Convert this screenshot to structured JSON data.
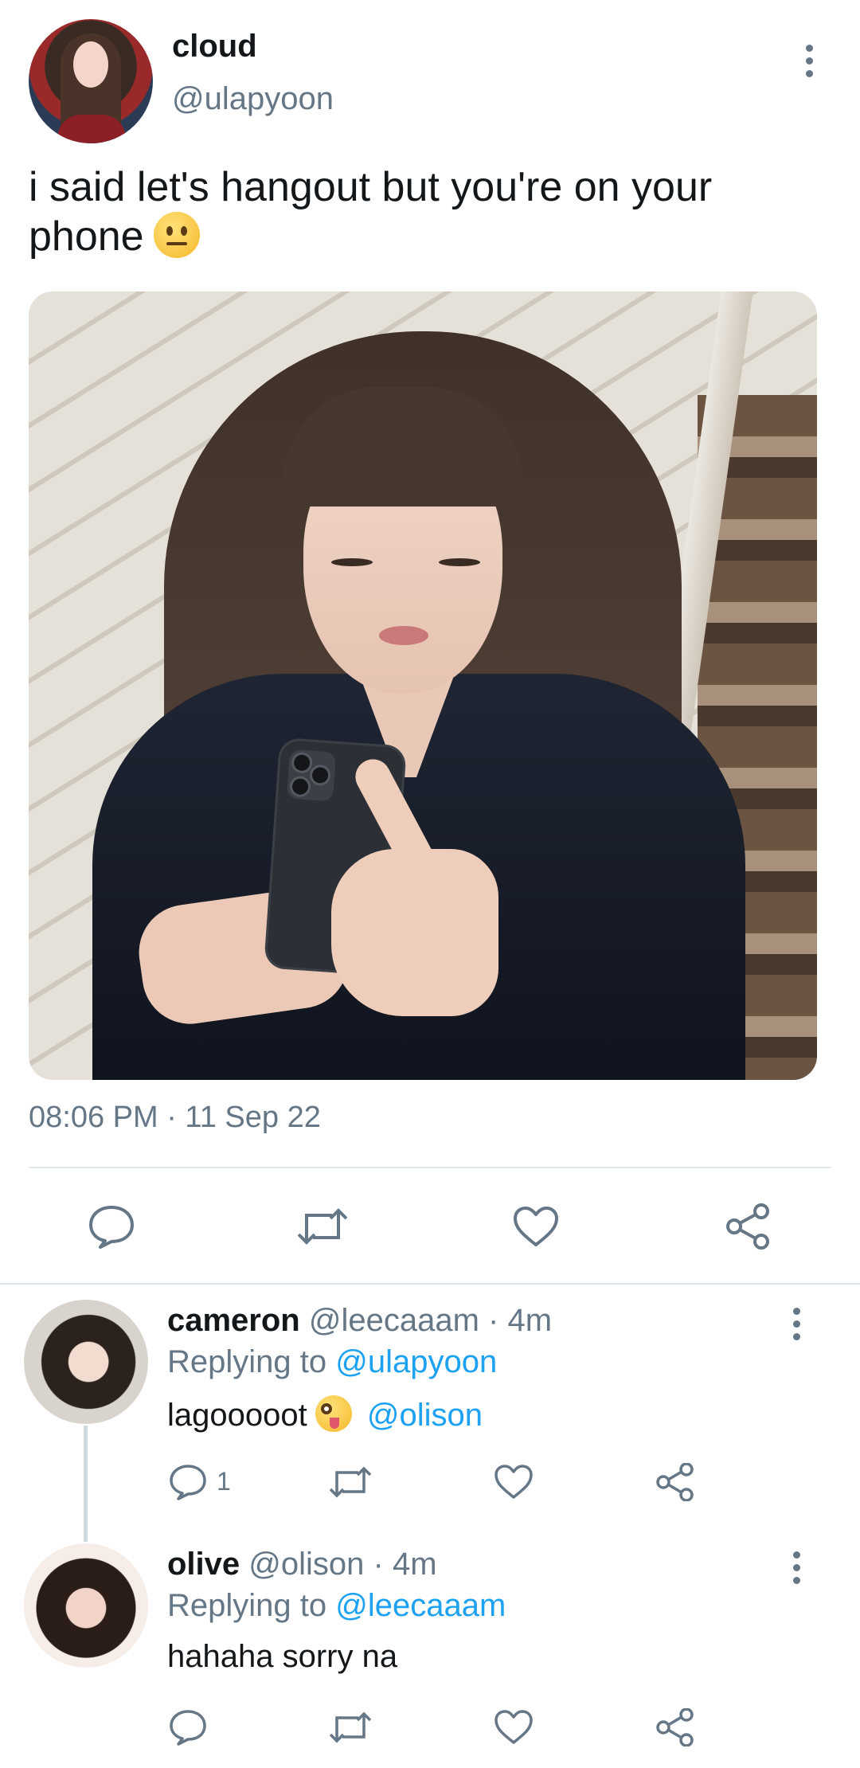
{
  "tweet": {
    "display_name": "cloud",
    "handle": "@ulapyoon",
    "text": "i said let's hangout but you're on your phone",
    "emoji": "neutral-face",
    "timestamp": "08:06 PM · 11 Sep 22",
    "actions": [
      "reply-icon",
      "retweet-icon",
      "like-icon",
      "share-icon"
    ]
  },
  "replies": [
    {
      "display_name": "cameron",
      "handle": "@leecaaam",
      "time": "· 4m",
      "replying_prefix": "Replying to",
      "replying_to": "@ulapyoon",
      "text": "lagooooot",
      "emoji": "zany-face",
      "mention": "@olison",
      "reply_count": "1"
    },
    {
      "display_name": "olive",
      "handle": "@olison",
      "time": "· 4m",
      "replying_prefix": "Replying to",
      "replying_to": "@leecaaam",
      "text": "hahaha sorry na"
    }
  ],
  "colors": {
    "text_primary": "#14171a",
    "text_secondary": "#657786",
    "link": "#1da1f2",
    "divider": "#e1e8ed"
  }
}
